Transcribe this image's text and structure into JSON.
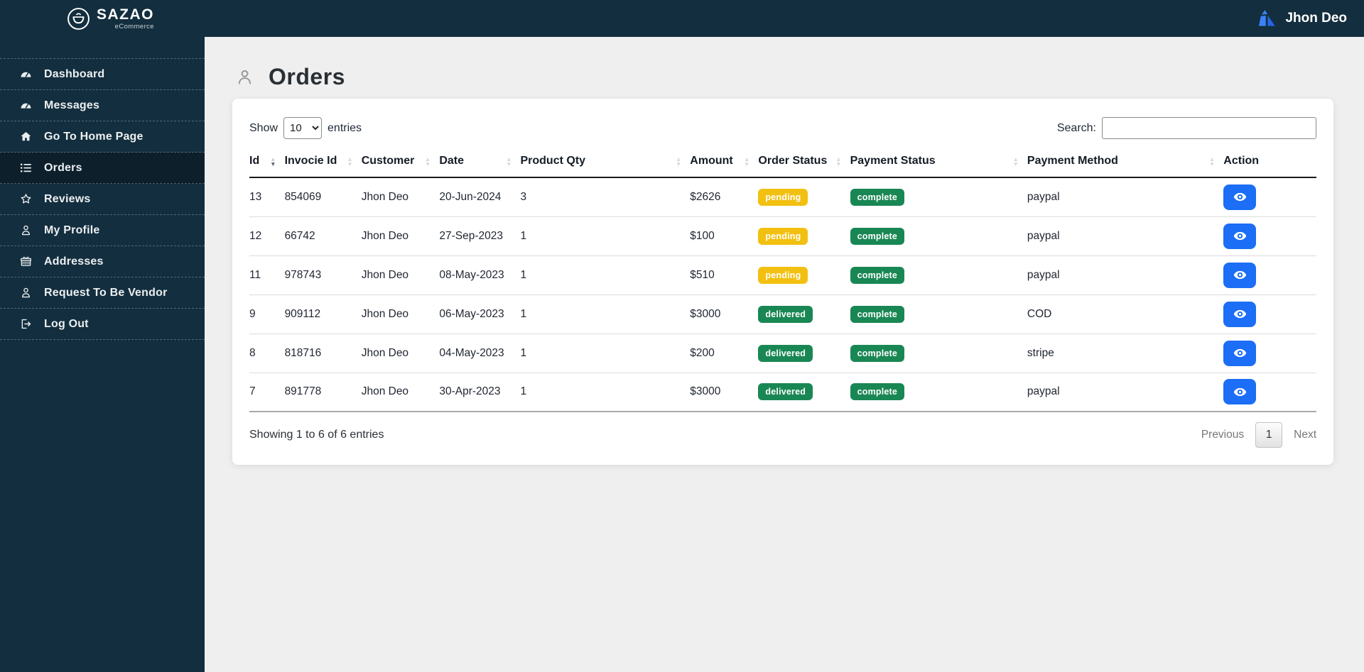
{
  "brand": {
    "name": "SAZAO",
    "tagline": "eCommerce"
  },
  "topbar": {
    "user_name": "Jhon Deo"
  },
  "sidebar": {
    "items": [
      {
        "label": "Dashboard",
        "name": "dashboard",
        "icon": "dashboard-gauge-icon",
        "glyph": "tachometer",
        "active": false
      },
      {
        "label": "Messages",
        "name": "messages",
        "icon": "messages-gauge-icon",
        "glyph": "tachometer",
        "active": false
      },
      {
        "label": "Go To Home Page",
        "name": "go-to-home-page",
        "icon": "home-icon",
        "glyph": "home",
        "active": false
      },
      {
        "label": "Orders",
        "name": "orders",
        "icon": "orders-list-icon",
        "glyph": "list",
        "active": true
      },
      {
        "label": "Reviews",
        "name": "reviews",
        "icon": "reviews-star-icon",
        "glyph": "star",
        "active": false
      },
      {
        "label": "My Profile",
        "name": "my-profile",
        "icon": "profile-user-icon",
        "glyph": "user",
        "active": false
      },
      {
        "label": "Addresses",
        "name": "addresses",
        "icon": "addresses-gift-icon",
        "glyph": "gift",
        "active": false
      },
      {
        "label": "Request To Be Vendor",
        "name": "request-to-be-vendor",
        "icon": "vendor-user-icon",
        "glyph": "user",
        "active": false
      },
      {
        "label": "Log Out",
        "name": "log-out",
        "icon": "logout-icon",
        "glyph": "logout",
        "active": false
      }
    ]
  },
  "page": {
    "title": "Orders",
    "title_icon": "person-icon"
  },
  "controls": {
    "show_label": "Show",
    "page_length": "10",
    "entries_label": "entries",
    "search_label": "Search:",
    "search_value": ""
  },
  "table": {
    "columns": [
      {
        "label": "Id",
        "sort": "desc"
      },
      {
        "label": "Invocie Id",
        "sort": "unsorted"
      },
      {
        "label": "Customer",
        "sort": "unsorted"
      },
      {
        "label": "Date",
        "sort": "unsorted"
      },
      {
        "label": "Product Qty",
        "sort": "unsorted"
      },
      {
        "label": "Amount",
        "sort": "unsorted"
      },
      {
        "label": "Order Status",
        "sort": "unsorted"
      },
      {
        "label": "Payment Status",
        "sort": "unsorted"
      },
      {
        "label": "Payment Method",
        "sort": "unsorted"
      },
      {
        "label": "Action",
        "sort": "none"
      }
    ],
    "action_icon": "eye-icon",
    "rows": [
      {
        "id": "13",
        "invoice_id": "854069",
        "customer": "Jhon Deo",
        "date": "20-Jun-2024",
        "product_qty": "3",
        "amount": "$2626",
        "order_status": "pending",
        "payment_status": "complete",
        "payment_method": "paypal"
      },
      {
        "id": "12",
        "invoice_id": "66742",
        "customer": "Jhon Deo",
        "date": "27-Sep-2023",
        "product_qty": "1",
        "amount": "$100",
        "order_status": "pending",
        "payment_status": "complete",
        "payment_method": "paypal"
      },
      {
        "id": "11",
        "invoice_id": "978743",
        "customer": "Jhon Deo",
        "date": "08-May-2023",
        "product_qty": "1",
        "amount": "$510",
        "order_status": "pending",
        "payment_status": "complete",
        "payment_method": "paypal"
      },
      {
        "id": "9",
        "invoice_id": "909112",
        "customer": "Jhon Deo",
        "date": "06-May-2023",
        "product_qty": "1",
        "amount": "$3000",
        "order_status": "delivered",
        "payment_status": "complete",
        "payment_method": "COD"
      },
      {
        "id": "8",
        "invoice_id": "818716",
        "customer": "Jhon Deo",
        "date": "04-May-2023",
        "product_qty": "1",
        "amount": "$200",
        "order_status": "delivered",
        "payment_status": "complete",
        "payment_method": "stripe"
      },
      {
        "id": "7",
        "invoice_id": "891778",
        "customer": "Jhon Deo",
        "date": "30-Apr-2023",
        "product_qty": "1",
        "amount": "$3000",
        "order_status": "delivered",
        "payment_status": "complete",
        "payment_method": "paypal"
      }
    ]
  },
  "footer": {
    "info": "Showing 1 to 6 of 6 entries",
    "previous_label": "Previous",
    "current_page": "1",
    "next_label": "Next"
  },
  "colors": {
    "topbar_bg": "#132e3e",
    "sidebar_bg": "#132e3e",
    "sidebar_active_bg": "#0c1f2b",
    "accent_blue": "#1b6ef5",
    "badge_pending_yellow": "#f2c010",
    "badge_complete_green": "#198754",
    "page_bg": "#efefef"
  }
}
